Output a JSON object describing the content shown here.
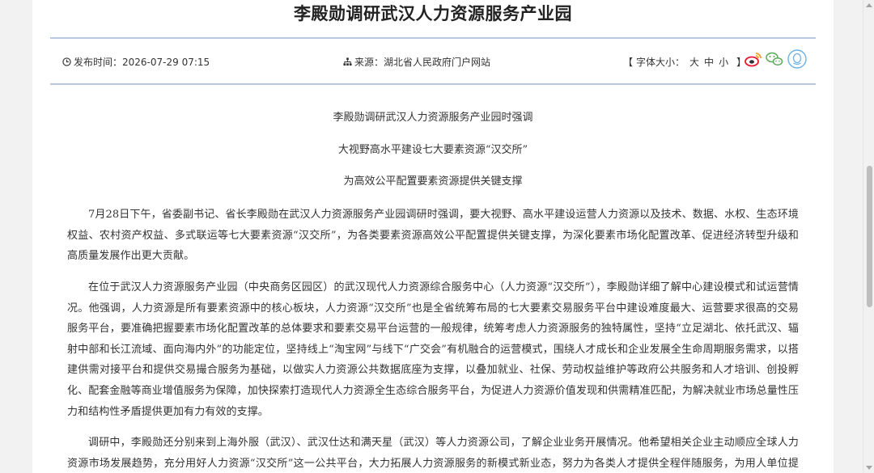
{
  "article": {
    "title": "李殿勋调研武汉人力资源服务产业园",
    "publish_time_label": "发布时间：",
    "publish_time": "2026-07-29 07:15",
    "source_label": "来源：",
    "source": "湖北省人民政府门户网站",
    "font_size_label": "字体大小：",
    "font_sizes": [
      "大",
      "中",
      "小"
    ],
    "bracket_open": "【",
    "bracket_close": "】",
    "subtitles": [
      "李殿勋调研武汉人力资源服务产业园时强调",
      "大视野高水平建设七大要素资源“汉交所”",
      "为高效公平配置要素资源提供关键支撑"
    ],
    "paragraphs": [
      "7月28日下午，省委副书记、省长李殿勋在武汉人力资源服务产业园调研时强调，要大视野、高水平建设运营人力资源以及技术、数据、水权、生态环境权益、农村资产权益、多式联运等七大要素资源“汉交所”，为各类要素资源高效公平配置提供关键支撑，为深化要素市场化配置改革、促进经济转型升级和高质量发展作出更大贡献。",
      "在位于武汉人力资源服务产业园（中央商务区园区）的武汉现代人力资源综合服务中心（人力资源“汉交所”），李殿勋详细了解中心建设模式和试运营情况。他强调，人力资源是所有要素资源中的核心板块，人力资源“汉交所”也是全省统筹布局的七大要素交易服务平台中建设难度最大、运营要求很高的交易服务平台，要准确把握要素市场化配置改革的总体要求和要素交易平台运营的一般规律，统筹考虑人力资源服务的独特属性，坚持“立足湖北、依托武汉、辐射中部和长江流域、面向海内外”的功能定位，坚持线上“淘宝网”与线下“广交会”有机融合的运营模式，围绕人才成长和企业发展全生命周期服务需求，以搭建供需对接平台和提供交易撮合服务为基础，以做实人力资源公共数据底座为支撑，以叠加就业、社保、劳动权益维护等政府公共服务和人才培训、创投孵化、配套金融等商业增值服务为保障，加快探索打造现代人力资源全生态综合服务平台，为促进人力资源价值发现和供需精准匹配，为解决就业市场总量性压力和结构性矛盾提供更加有力有效的支撑。",
      "调研中，李殿勋还分别来到上海外服（武汉）、武汉仕达和满天星（武汉）等人力资源公司，了解企业业务开展情况。他希望相关企业主动顺应全球人力资源市场发展趋势，充分用好人力资源“汉交所”这一公共平台，大力拓展人力资源服务的新模式新业态，努力为各类人才提供全程伴随服务，为用人单位提供整体解"
    ]
  },
  "icons": {
    "time": "clock-icon",
    "source": "sitemap-icon",
    "weibo": "weibo-icon",
    "wechat": "wechat-icon",
    "qzone": "qzone-icon"
  },
  "colors": {
    "rule": "#b9c7e3",
    "weibo_red": "#e6162d",
    "weibo_orange": "#f59a23",
    "wechat_green": "#5aa85a",
    "qzone_blue": "#6db0e3"
  }
}
